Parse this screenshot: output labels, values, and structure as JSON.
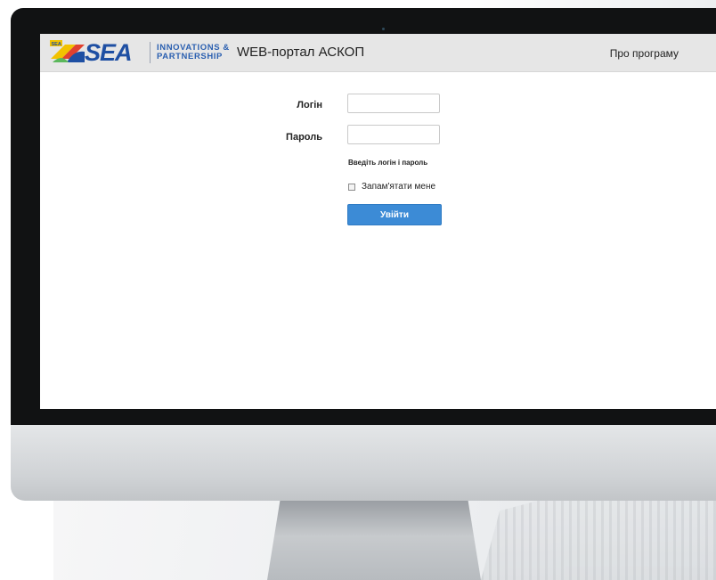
{
  "colors": {
    "accent": "#3c8bd6",
    "header_bg": "#e6e6e6",
    "logo_blue": "#1e4fa3",
    "logo_yellow": "#f2c200",
    "logo_red": "#e0412f"
  },
  "logo": {
    "badge": "SEA",
    "wordmark": "SEA",
    "tagline_line1": "INNOVATIONS &",
    "tagline_line2": "PARTNERSHIP"
  },
  "header": {
    "title": "WEB-портал АСКОП",
    "about_link": "Про програму"
  },
  "login_form": {
    "login_label": "Логін",
    "login_value": "",
    "password_label": "Пароль",
    "password_value": "",
    "hint": "Введіть логін і пароль",
    "remember_label": "Запам'ятати мене",
    "remember_checked": false,
    "submit_label": "Увійти"
  }
}
